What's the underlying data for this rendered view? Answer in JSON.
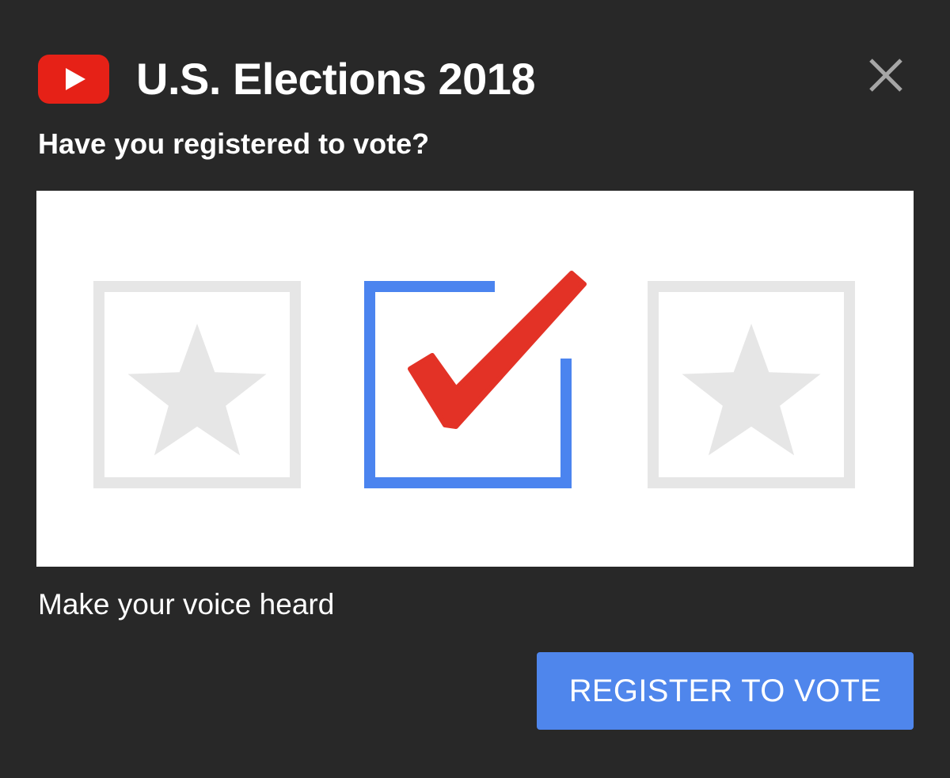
{
  "dialog": {
    "title": "U.S. Elections 2018",
    "question": "Have you registered to vote?",
    "tagline": "Make your voice heard",
    "register_label": "REGISTER TO VOTE",
    "logo_icon": "youtube-logo-icon",
    "close_icon": "close-icon",
    "banner_icons": [
      "star-box-icon",
      "checked-box-icon",
      "star-box-icon"
    ]
  },
  "colors": {
    "background": "#282828",
    "logo_red": "#e62117",
    "check_red": "#e33226",
    "box_blue": "#4b84ef",
    "star_gray": "#e6e6e6",
    "button_blue": "#4f86ec",
    "close_gray": "#a6a6a6"
  }
}
